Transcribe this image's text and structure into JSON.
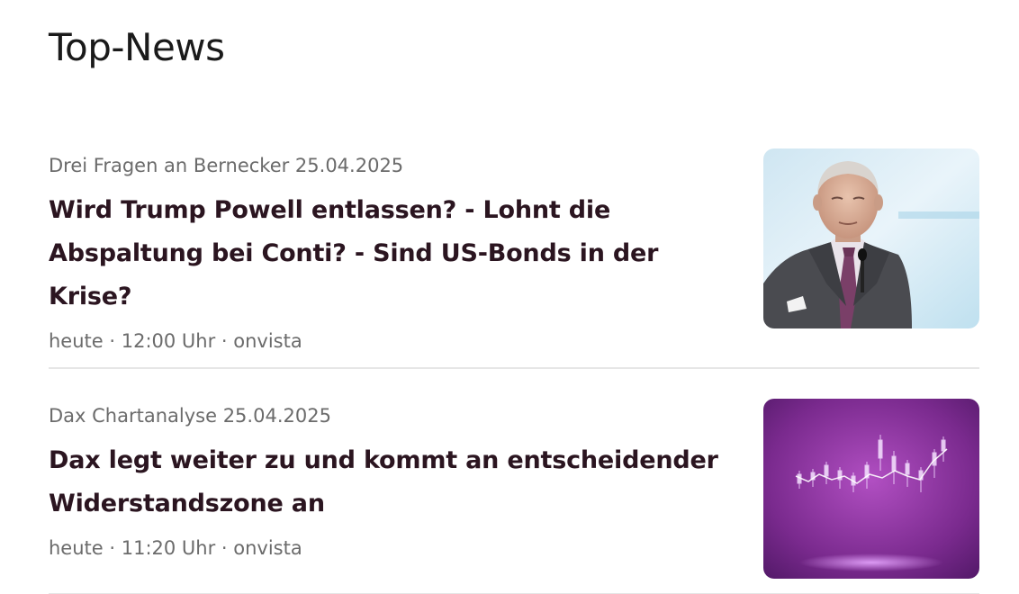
{
  "section": {
    "title": "Top-News"
  },
  "articles": [
    {
      "kicker": "Drei Fragen an Bernecker 25.04.2025",
      "headline_lines": [
        "Wird Trump Powell entlassen? - Lohnt die",
        "Abspaltung bei Conti? - Sind US-Bonds in der",
        "Krise?"
      ],
      "meta": "heute · 12:00 Uhr · onvista",
      "image_icon": "portrait-photo"
    },
    {
      "kicker": "Dax Chartanalyse 25.04.2025",
      "headline_lines": [
        "Dax legt weiter zu und kommt an entscheidender",
        "Widerstandszone an"
      ],
      "meta": "heute · 11:20 Uhr · onvista",
      "image_icon": "candlestick-chart-photo"
    }
  ],
  "colors": {
    "headline": "#2b1520",
    "muted": "#6b6b6b",
    "divider": "#e6e6e6"
  }
}
